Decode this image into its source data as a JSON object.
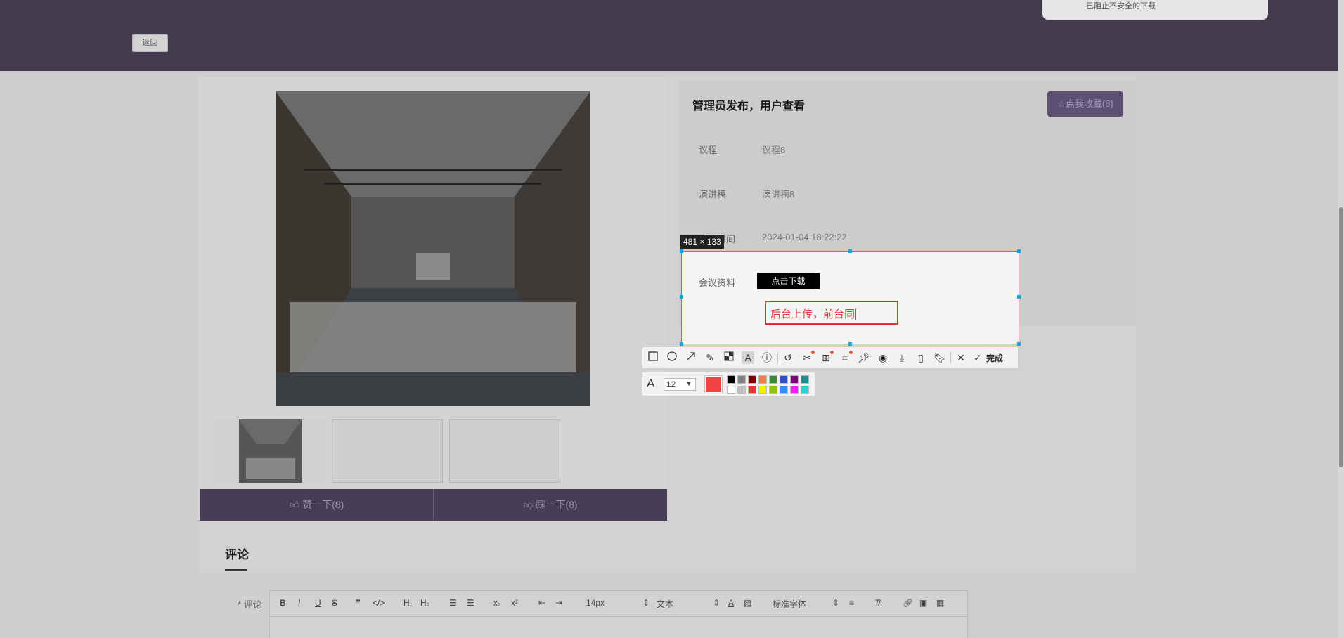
{
  "header": {
    "notice_text": "已阻止不安全的下载",
    "back_label": "返回"
  },
  "gallery": {
    "vote_up_label": "赞一下(8)",
    "vote_down_label": "踩一下(8)"
  },
  "details": {
    "title": "管理员发布，用户查看",
    "favorite_label": "☆点我收藏(8)",
    "fields": [
      {
        "label": "议程",
        "value": "议程8"
      },
      {
        "label": "演讲稿",
        "value": "演讲稿8"
      },
      {
        "label": "会议时间",
        "value": "2024-01-04 18:22:22"
      },
      {
        "label": "会议资料",
        "value": ""
      }
    ],
    "download_label": "点击下载"
  },
  "screenshot_tool": {
    "dimension_label": "481 × 133",
    "text_annotation": "后台上传，前台同",
    "done_label": "完成",
    "font_size_value": "12",
    "current_color": "#f04444",
    "palette": [
      "#000000",
      "#808080",
      "#800000",
      "#f08040",
      "#3a8a3a",
      "#3050c0",
      "#800080",
      "#1a9090",
      "#ffffff",
      "#c0c0c0",
      "#f03030",
      "#f0f000",
      "#90c010",
      "#3090f0",
      "#f020f0",
      "#30d0d0"
    ]
  },
  "comments": {
    "title": "评论",
    "field_label": "* 评论",
    "font_size_select": "14px",
    "format_select": "文本",
    "font_family_select": "标准字体"
  }
}
